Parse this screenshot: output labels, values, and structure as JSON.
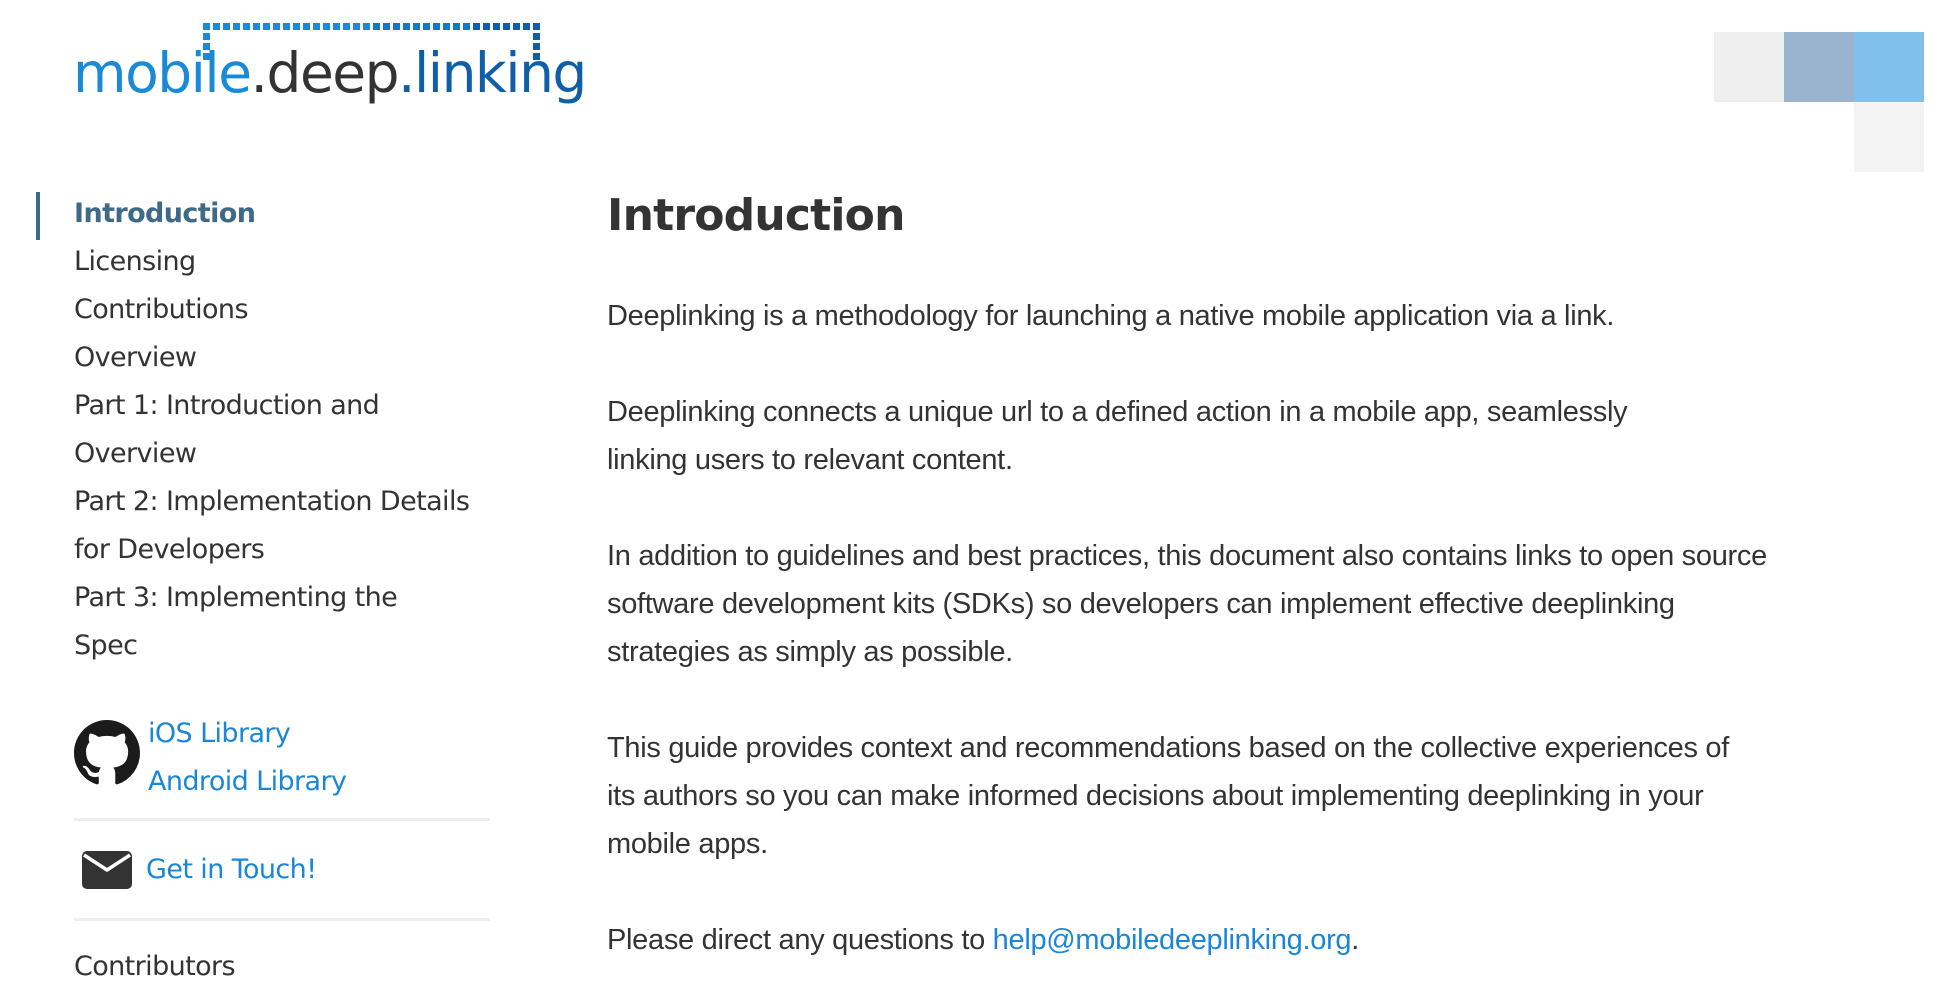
{
  "logo": {
    "part1": "mobile",
    "part2": ".deep",
    "part3": ".linking",
    "colors": {
      "part1": "#1a8ad6",
      "part2": "#333333",
      "part3": "#0e5fa8"
    }
  },
  "sidebar": {
    "nav": [
      {
        "label": "Introduction",
        "active": true
      },
      {
        "label": "Licensing"
      },
      {
        "label": "Contributions"
      },
      {
        "label": "Overview"
      },
      {
        "label": "Part 1: Introduction and Overview"
      },
      {
        "label": "Part 2: Implementation Details for Developers"
      },
      {
        "label": "Part 3: Implementing the Spec"
      }
    ],
    "libraries": {
      "icon": "github-icon",
      "links": [
        {
          "label": "iOS Library"
        },
        {
          "label": "Android Library"
        }
      ]
    },
    "contact": {
      "icon": "envelope-icon",
      "label": "Get in Touch!"
    },
    "contributors_label": "Contributors"
  },
  "main": {
    "title": "Introduction",
    "paragraphs": [
      "Deeplinking is a methodology for launching a native mobile application via a link.",
      "Deeplinking connects a unique url to a defined action in a mobile app, seamlessly linking users to relevant content.",
      "In addition to guidelines and best practices, this document also contains links to open source software development kits (SDKs) so developers can implement effective deeplinking strategies as simply as possible.",
      "This guide provides context and recommendations based on the collective experiences of its authors so you can make informed decisions about implementing deeplinking in your mobile apps."
    ],
    "contact_line": {
      "prefix": "Please direct any questions to ",
      "email": "help@mobiledeeplinking.org",
      "suffix": "."
    }
  },
  "theme": {
    "accent": "#3e6a87",
    "link": "#1a87d6",
    "text": "#333333",
    "deco_squares": [
      "#efeff0",
      "#9ab4d0",
      "#80c0ea",
      "#f3f3f4"
    ]
  }
}
